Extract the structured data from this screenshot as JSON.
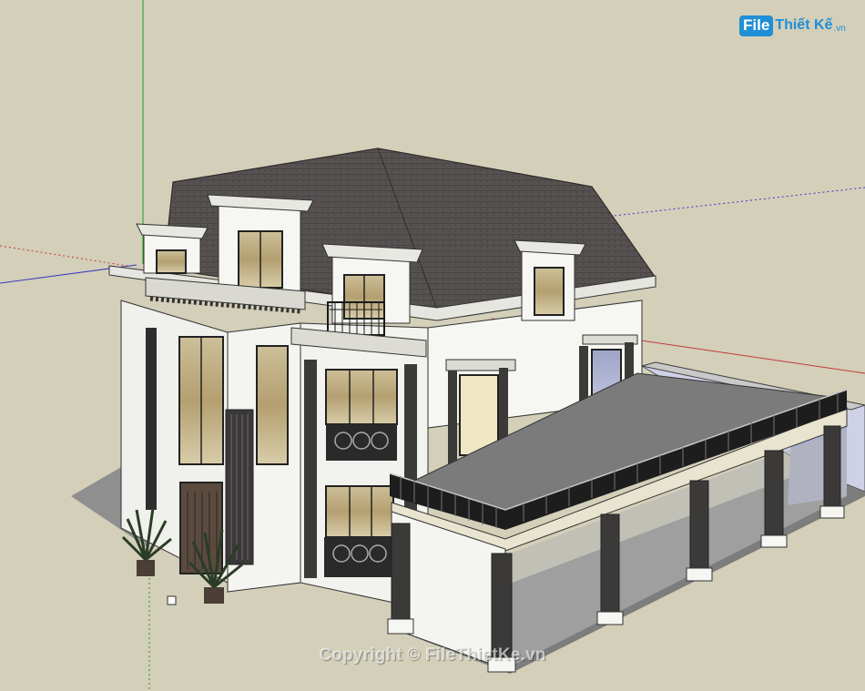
{
  "app": {
    "background": "#d3cfb9",
    "axes": {
      "green_axis": "#1e9a1e",
      "red_axis": "#c43a3a",
      "blue_axis": "#3a3ac4"
    }
  },
  "brand": {
    "logo_file": "File",
    "logo_rest": "Thiết Kế",
    "logo_tld": ".vn",
    "accent": "#1f8fd6"
  },
  "watermark": {
    "text": "Copyright © FileThietKe.vn"
  },
  "model": {
    "roof_color": "#555050",
    "wall_color": "#f4f4f0",
    "trim_color": "#3c3a38",
    "glass_color": "#b8a980",
    "deck_color": "#7b7b7b",
    "ground_plane_color": "#8a8a8a"
  }
}
